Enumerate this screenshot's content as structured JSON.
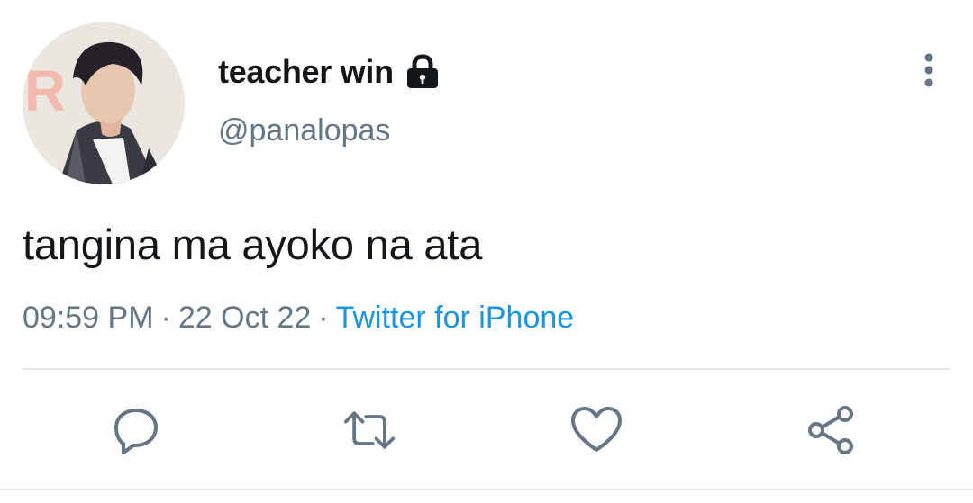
{
  "author": {
    "display_name": "teacher win",
    "handle": "@panalopas",
    "protected": true,
    "avatar": "profile-photo"
  },
  "tweet": {
    "text": "tangina ma ayoko na ata",
    "time": "09:59 PM",
    "date": "22 Oct 22",
    "separator": "·",
    "source": "Twitter for iPhone"
  },
  "icons": {
    "lock": "lock-icon",
    "more": "more-vertical-icon",
    "reply": "reply-icon",
    "retweet": "retweet-icon",
    "like": "heart-icon",
    "share": "share-icon"
  },
  "colors": {
    "text_primary": "#14171a",
    "text_secondary": "#657786",
    "link": "#1b95e0",
    "icon": "#657786",
    "divider": "#e1e8ed"
  }
}
